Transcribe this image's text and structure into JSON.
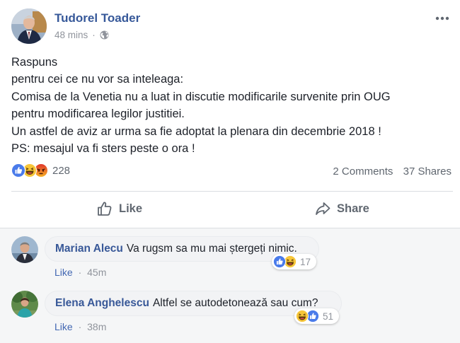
{
  "post": {
    "author": "Tudorel Toader",
    "time": "48 mins",
    "separator": "·",
    "privacy_icon": "globe-icon",
    "lines": [
      "Raspuns",
      "pentru cei ce nu vor sa inteleaga:",
      "Comisa de la Venetia nu a luat in discutie modificarile survenite prin OUG",
      "pentru modificarea legilor justitiei.",
      "Un astfel de aviz ar urma sa fie adoptat la plenara din decembrie 2018 !",
      "PS: mesajul va fi sters peste o ora !"
    ]
  },
  "stats": {
    "reactions": [
      "like",
      "haha",
      "angry"
    ],
    "reaction_count": "228",
    "comments": "2 Comments",
    "shares": "37 Shares"
  },
  "actions": {
    "like_label": "Like",
    "share_label": "Share"
  },
  "comments": [
    {
      "name": "Marian Alecu",
      "text": "Va rugsm sa mu mai ștergeți nimic.",
      "like_label": "Like",
      "separator": "·",
      "time": "45m",
      "reactions": [
        "like",
        "haha"
      ],
      "reaction_count": "17"
    },
    {
      "name": "Elena Anghelescu",
      "text": "Altfel se autodetonează sau cum?",
      "like_label": "Like",
      "separator": "·",
      "time": "38m",
      "reactions": [
        "haha",
        "like"
      ],
      "reaction_count": "51"
    }
  ],
  "colors": {
    "brand_link": "#365899",
    "like_blue": "#4267b2",
    "haha_yellow": "#f7b125",
    "angry_orange": "#e9710f",
    "muted_text": "#90949c"
  }
}
